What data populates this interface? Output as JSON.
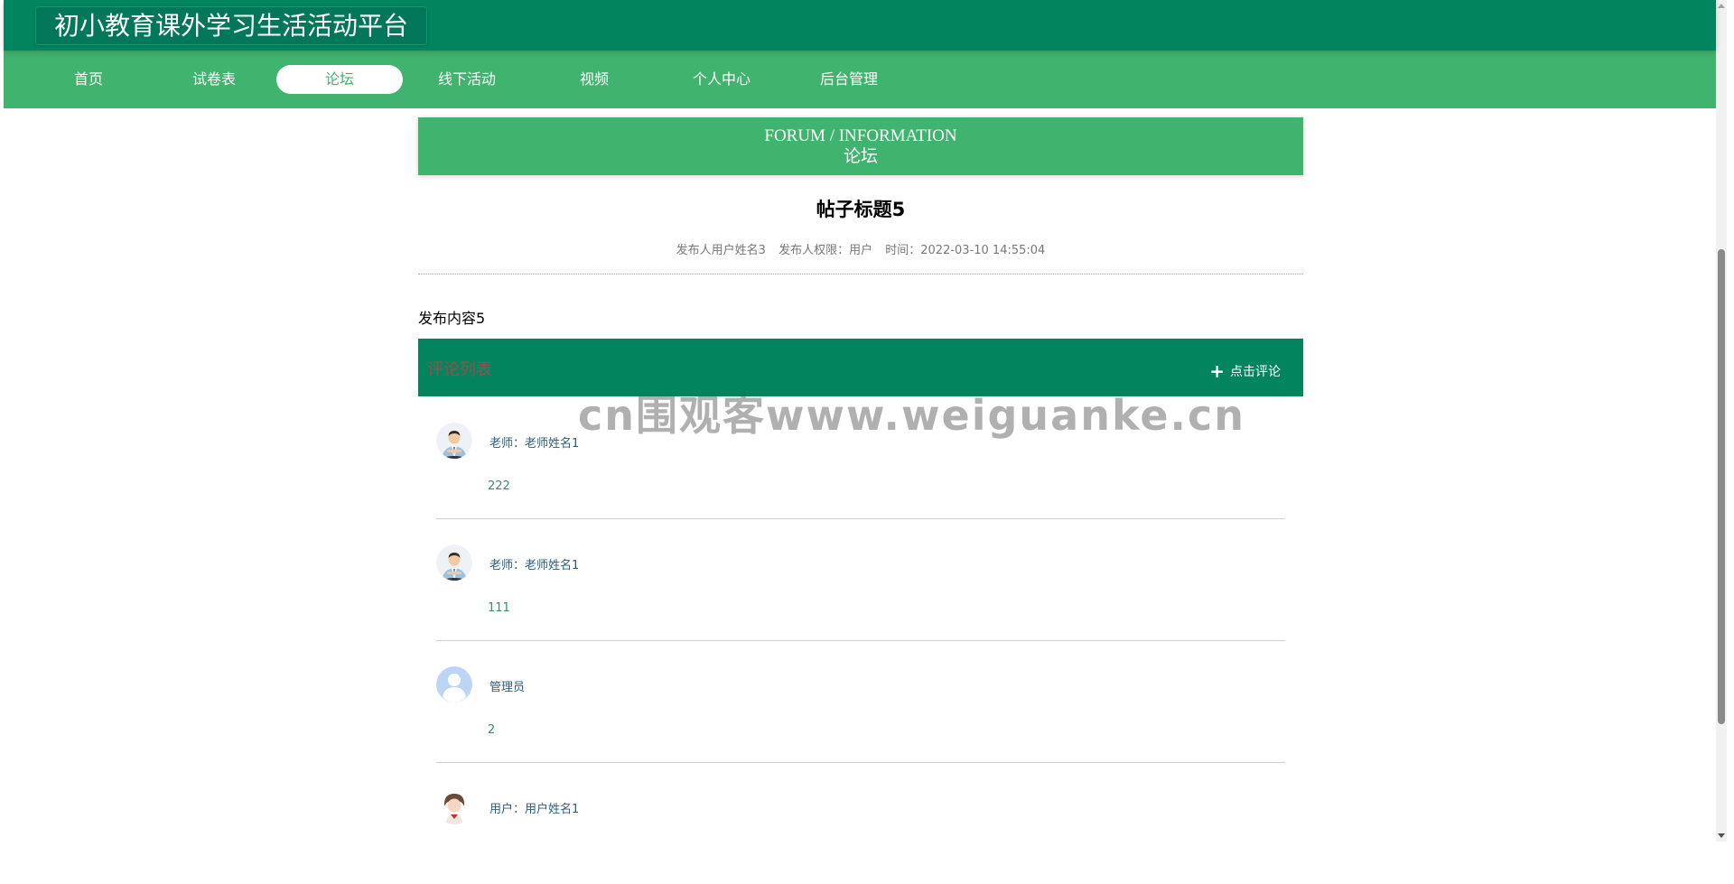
{
  "header": {
    "title": "初小教育课外学习生活活动平台"
  },
  "nav": {
    "items": [
      {
        "label": "首页"
      },
      {
        "label": "试卷表"
      },
      {
        "label": "论坛",
        "active": true
      },
      {
        "label": "线下活动"
      },
      {
        "label": "视频"
      },
      {
        "label": "个人中心"
      },
      {
        "label": "后台管理"
      }
    ]
  },
  "banner": {
    "english": "FORUM / INFORMATION",
    "chinese": "论坛"
  },
  "post": {
    "title": "帖子标题5",
    "author": "发布人用户姓名3",
    "role": "发布人权限：用户",
    "time": "时间：2022-03-10 14:55:04",
    "content": "发布内容5"
  },
  "comments": {
    "title": "评论列表",
    "add_label": "点击评论",
    "items": [
      {
        "author": "老师：老师姓名1",
        "text": "222",
        "avatar": "teacher-avatar-icon"
      },
      {
        "author": "老师：老师姓名1",
        "text": "111",
        "avatar": "teacher-avatar-icon"
      },
      {
        "author": "管理员",
        "text": "2",
        "avatar": "default-avatar-icon"
      },
      {
        "author": "用户：用户姓名1",
        "text": "",
        "avatar": "user-avatar-icon"
      }
    ]
  },
  "watermark": "cn围观客www.weiguanke.cn",
  "colors": {
    "header_bg": "#02855f",
    "nav_bg": "#40b36e",
    "banner_bg": "#40b36e",
    "comments_header_bg": "#02855f",
    "comments_title": "#a04a4a",
    "comment_author": "#2c5c7c",
    "comment_text": "#3a8a72"
  }
}
